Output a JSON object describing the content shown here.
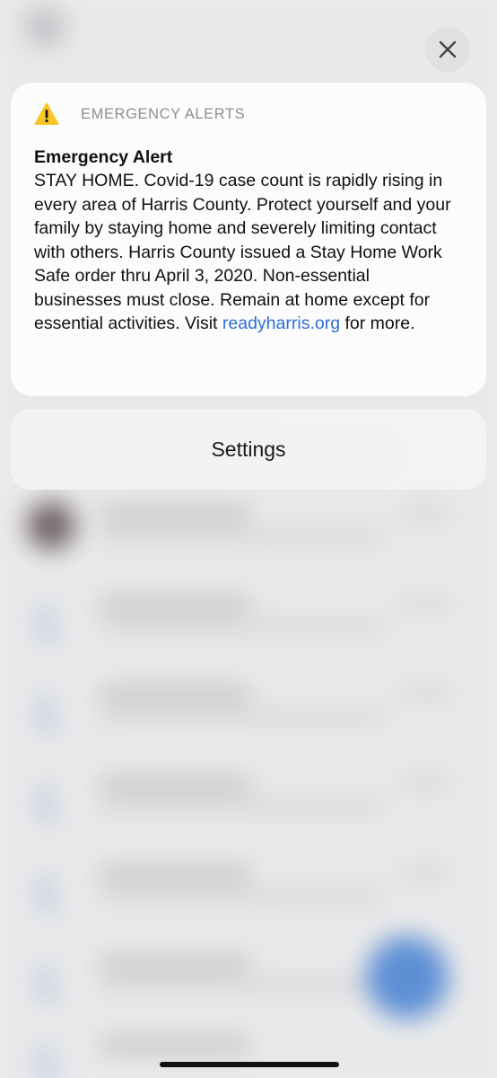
{
  "alert": {
    "app_name": "EMERGENCY ALERTS",
    "app_icon": "warning-triangle-icon",
    "title": "Emergency Alert",
    "body_text": "STAY HOME. Covid-19 case count is rapidly rising in every area of Harris County. Protect yourself and your family by staying home and severely limiting contact with others. Harris County issued a Stay Home Work Safe order thru April 3, 2020. Non-essential businesses must close. Remain at home except for essential activities. Visit ",
    "link_text": "readyharris.org",
    "body_suffix": " for more."
  },
  "actions": {
    "settings_label": "Settings",
    "close_icon": "close-icon"
  },
  "colors": {
    "warning_yellow": "#f7c525",
    "link_blue": "#2e6fd6",
    "fab_blue": "#5d8fd5"
  }
}
